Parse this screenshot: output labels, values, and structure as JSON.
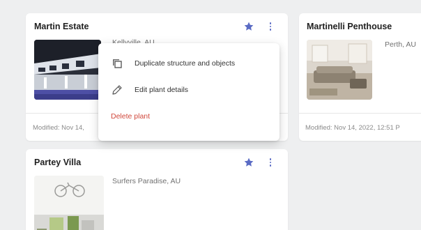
{
  "cards": [
    {
      "title": "Martin Estate",
      "location": "Kellyville, AU",
      "modified": "Modified: Nov 14,"
    },
    {
      "title": "Martinelli Penthouse",
      "location": "Perth, AU",
      "modified": "Modified: Nov 14, 2022, 12:51 P"
    },
    {
      "title": "Partey Villa",
      "location": "Surfers Paradise, AU"
    }
  ],
  "context_menu": {
    "items": [
      {
        "label": "Duplicate structure and objects",
        "icon": "copy-icon"
      },
      {
        "label": "Edit plant details",
        "icon": "pencil-icon"
      },
      {
        "label": "Delete plant",
        "icon": "none"
      }
    ]
  },
  "colors": {
    "accent": "#5a6bc4",
    "danger": "#d0473b",
    "background": "#eeeff0"
  }
}
